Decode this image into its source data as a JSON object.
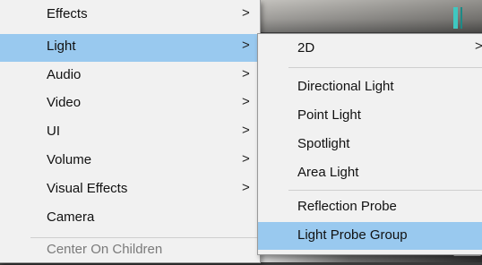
{
  "menu": {
    "items": [
      {
        "label": "Effects",
        "arrow": ">"
      },
      {
        "label": "Light",
        "arrow": ">"
      },
      {
        "label": "Audio",
        "arrow": ">"
      },
      {
        "label": "Video",
        "arrow": ">"
      },
      {
        "label": "UI",
        "arrow": ">"
      },
      {
        "label": "Volume",
        "arrow": ">"
      },
      {
        "label": "Visual Effects",
        "arrow": ">"
      },
      {
        "label": "Camera"
      },
      {
        "label": "Center On Children"
      }
    ]
  },
  "submenu": {
    "items": [
      {
        "label": "2D",
        "arrow": ">"
      },
      {
        "label": "Directional Light"
      },
      {
        "label": "Point Light"
      },
      {
        "label": "Spotlight"
      },
      {
        "label": "Area Light"
      },
      {
        "label": "Reflection Probe"
      },
      {
        "label": "Light Probe Group"
      }
    ]
  },
  "colors": {
    "highlight": "#99c9ef",
    "menu_background": "#f1f1f1",
    "disabled_text": "#7a7a7a"
  }
}
